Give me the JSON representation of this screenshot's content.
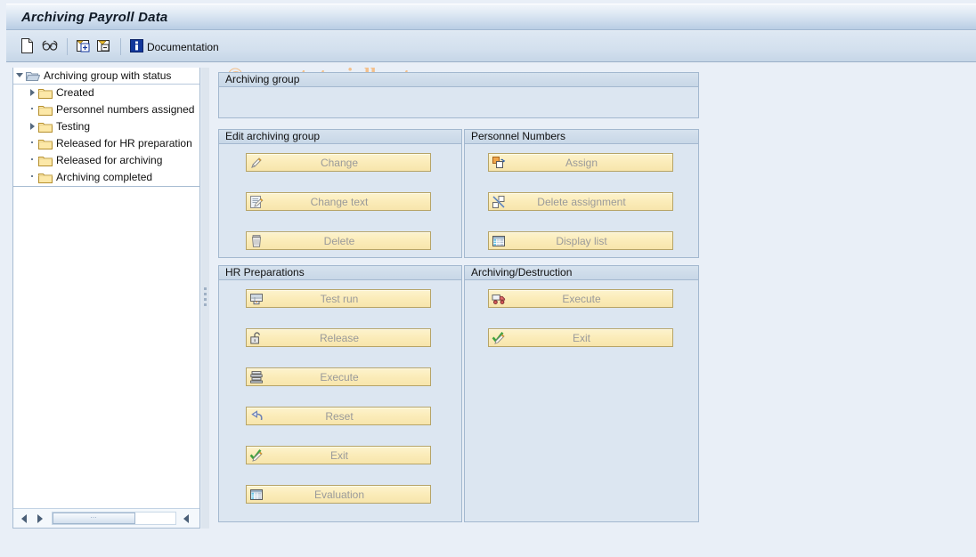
{
  "window": {
    "title": "Archiving Payroll Data"
  },
  "toolbar": {
    "items": [
      {
        "name": "new-document",
        "icon": "page-icon",
        "label": ""
      },
      {
        "name": "find",
        "icon": "glasses-icon",
        "label": ""
      },
      {
        "name": "expand-all",
        "icon": "expand-node-icon",
        "label": ""
      },
      {
        "name": "collapse-all",
        "icon": "collapse-node-icon",
        "label": ""
      },
      {
        "name": "documentation",
        "icon": "info-icon",
        "label": "Documentation"
      }
    ],
    "documentation_label": "Documentation"
  },
  "watermark": "© www.tutorialkart.com",
  "tree": {
    "root": {
      "label": "Archiving group with status",
      "expanded": true
    },
    "items": [
      {
        "label": "Created",
        "toggle": "collapsed"
      },
      {
        "label": "Personnel numbers assigned",
        "toggle": "leaf"
      },
      {
        "label": "Testing",
        "toggle": "collapsed"
      },
      {
        "label": "Released for HR preparation",
        "toggle": "leaf"
      },
      {
        "label": "Released for archiving",
        "toggle": "leaf"
      },
      {
        "label": "Archiving completed",
        "toggle": "leaf"
      }
    ],
    "scrollbar": {
      "grip": "⋯"
    }
  },
  "panels": {
    "archiving_group": {
      "title": "Archiving group",
      "content": ""
    },
    "edit_archiving_group": {
      "title": "Edit archiving group",
      "buttons": [
        {
          "label": "Change",
          "icon": "pencil-icon",
          "enabled": false
        },
        {
          "label": "Change text",
          "icon": "edit-text-icon",
          "enabled": false
        },
        {
          "label": "Delete",
          "icon": "trash-icon",
          "enabled": false
        }
      ]
    },
    "personnel_numbers": {
      "title": "Personnel Numbers",
      "buttons": [
        {
          "label": "Assign",
          "icon": "assign-icon",
          "enabled": false
        },
        {
          "label": "Delete assignment",
          "icon": "delete-assignment-icon",
          "enabled": false
        },
        {
          "label": "Display list",
          "icon": "list-icon",
          "enabled": false
        }
      ]
    },
    "hr_preparations": {
      "title": "HR Preparations",
      "buttons": [
        {
          "label": "Test run",
          "icon": "test-run-icon",
          "enabled": false
        },
        {
          "label": "Release",
          "icon": "unlock-icon",
          "enabled": false
        },
        {
          "label": "Execute",
          "icon": "execute-icon",
          "enabled": false
        },
        {
          "label": "Reset",
          "icon": "undo-icon",
          "enabled": false
        },
        {
          "label": "Exit",
          "icon": "check-pencil-icon",
          "enabled": false
        },
        {
          "label": "Evaluation",
          "icon": "evaluation-icon",
          "enabled": false
        }
      ]
    },
    "archiving_destruction": {
      "title": "Archiving/Destruction",
      "buttons": [
        {
          "label": "Execute",
          "icon": "truck-icon",
          "enabled": false
        },
        {
          "label": "Exit",
          "icon": "check-pencil-icon",
          "enabled": false
        }
      ]
    }
  },
  "colors": {
    "title_bar": "#b9cde4",
    "toolbar": "#d3e0ee",
    "panel_bg": "#dce6f1",
    "button_face": "#fbecb9",
    "button_border": "#b6a468",
    "disabled_text": "#9a9a9a",
    "watermark": "#f3c08c"
  }
}
